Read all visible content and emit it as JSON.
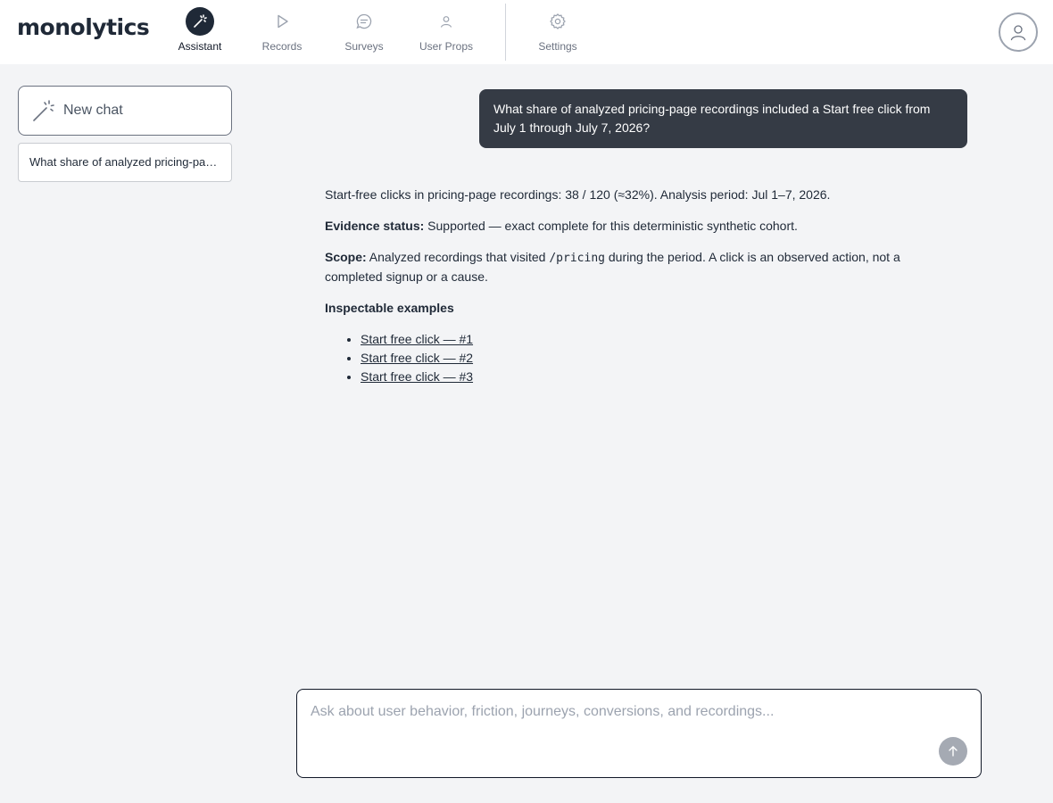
{
  "app": {
    "logo": "monolytics"
  },
  "nav": {
    "items": [
      {
        "label": "Assistant",
        "icon": "magic-wand-icon",
        "active": true
      },
      {
        "label": "Records",
        "icon": "play-icon"
      },
      {
        "label": "Surveys",
        "icon": "chat-bubble-icon"
      },
      {
        "label": "User Props",
        "icon": "user-icon"
      },
      {
        "label": "Settings",
        "icon": "gear-icon"
      }
    ],
    "profile_icon": "user-circle-icon"
  },
  "sidebar": {
    "new_chat_label": "New chat",
    "history": [
      {
        "title": "What share of analyzed pricing-page recordings included a Start free click from July 1 through July 7, 2026?"
      }
    ]
  },
  "conversation": {
    "user_message": "What share of analyzed pricing-page recordings included a Start free click from July 1 through July 7, 2026?",
    "answer": {
      "summary": "Start-free clicks in pricing-page recordings: 38 / 120 (≈32%). Analysis period: Jul 1–7, 2026.",
      "evidence_label": "Evidence status:",
      "evidence_text": " Supported — exact complete for this deterministic synthetic cohort.",
      "scope_label": "Scope:",
      "scope_text_before": " Analyzed recordings that visited ",
      "scope_code": "/pricing",
      "scope_text_after": " during the period. A click is an observed action, not a completed signup or a cause.",
      "examples_heading": "Inspectable examples",
      "examples": [
        {
          "label": "Start free click — #1"
        },
        {
          "label": "Start free click — #2"
        },
        {
          "label": "Start free click — #3"
        }
      ]
    }
  },
  "composer": {
    "placeholder": "Ask about user behavior, friction, journeys, conversions, and recordings...",
    "value": "",
    "send_icon": "arrow-up-icon"
  },
  "colors": {
    "background": "#f3f4f6",
    "user_bubble": "#353b45",
    "active_nav": "#1f2937",
    "send_button": "#a5aab3"
  }
}
